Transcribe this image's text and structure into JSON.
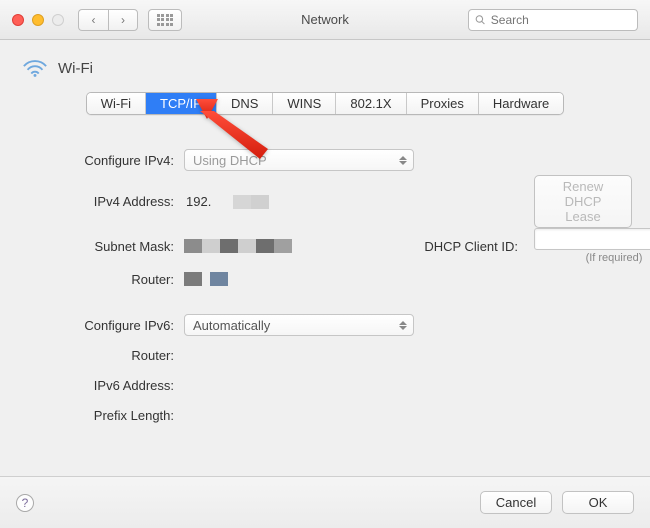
{
  "window": {
    "title": "Network",
    "search_placeholder": "Search"
  },
  "header": {
    "label": "Wi-Fi"
  },
  "tabs": [
    {
      "label": "Wi-Fi",
      "active": false
    },
    {
      "label": "TCP/IP",
      "active": true
    },
    {
      "label": "DNS",
      "active": false
    },
    {
      "label": "WINS",
      "active": false
    },
    {
      "label": "802.1X",
      "active": false
    },
    {
      "label": "Proxies",
      "active": false
    },
    {
      "label": "Hardware",
      "active": false
    }
  ],
  "ipv4": {
    "configure_label": "Configure IPv4:",
    "configure_value": "Using DHCP",
    "address_label": "IPv4 Address:",
    "address_value": "192.",
    "subnet_label": "Subnet Mask:",
    "router_label": "Router:",
    "renew_button": "Renew DHCP Lease",
    "dhcp_client_label": "DHCP Client ID:",
    "dhcp_client_value": "",
    "if_required": "(If required)"
  },
  "ipv6": {
    "configure_label": "Configure IPv6:",
    "configure_value": "Automatically",
    "router_label": "Router:",
    "address_label": "IPv6 Address:",
    "prefix_label": "Prefix Length:"
  },
  "footer": {
    "help": "?",
    "cancel": "Cancel",
    "ok": "OK"
  }
}
